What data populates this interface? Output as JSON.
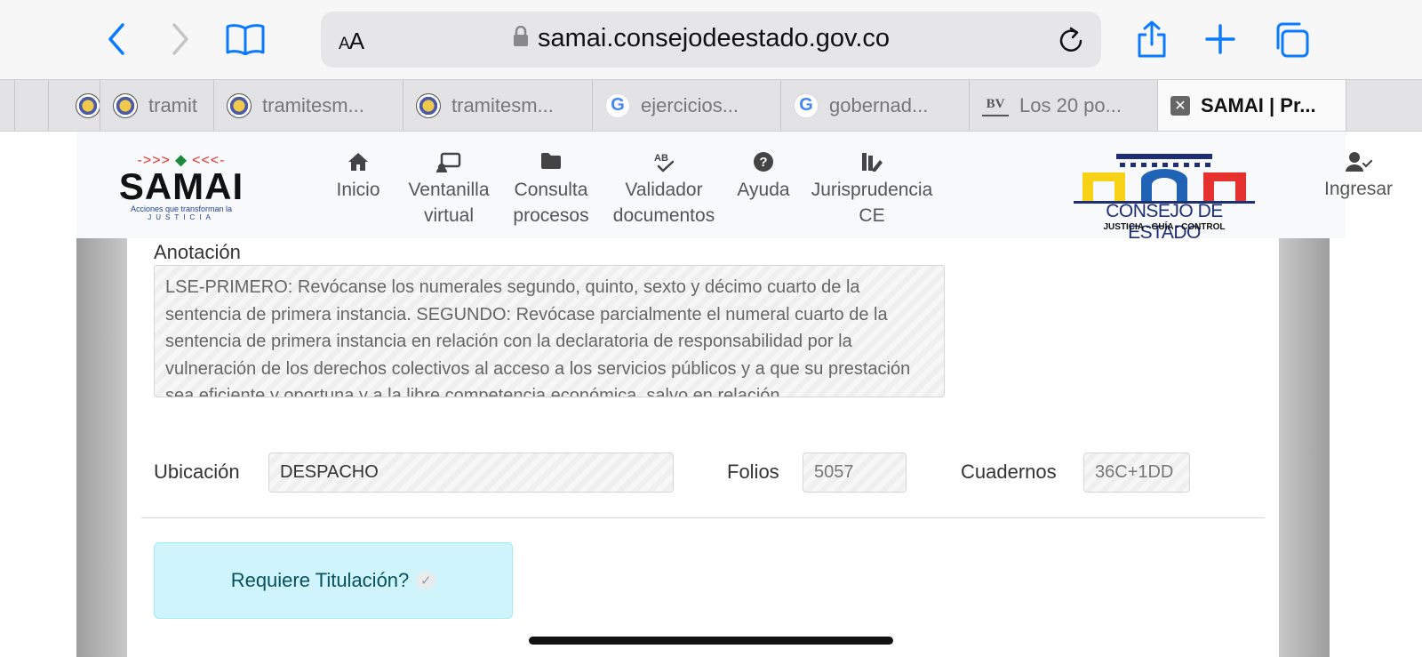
{
  "browser": {
    "text_size_label": "AA",
    "url": "samai.consejodeestado.gov.co",
    "colors": {
      "accent": "#0a7aff"
    }
  },
  "tabs": [
    {
      "label": "",
      "favicon": "coat-of-arms-icon"
    },
    {
      "label": "tramit",
      "favicon": "coat-of-arms-icon"
    },
    {
      "label": "tramitesm...",
      "favicon": "coat-of-arms-icon"
    },
    {
      "label": "tramitesm...",
      "favicon": "coat-of-arms-icon"
    },
    {
      "label": "ejercicios...",
      "favicon": "google-icon"
    },
    {
      "label": "gobernad...",
      "favicon": "google-icon"
    },
    {
      "label": "Los 20 po...",
      "favicon": "bv-icon"
    },
    {
      "label": "SAMAI | Pr...",
      "favicon": "close-icon",
      "active": true
    }
  ],
  "site": {
    "logo": {
      "word": "SAMAI",
      "tagline": "Acciones que transforman la",
      "tagline2": "JUSTICIA"
    },
    "nav": {
      "inicio": "Inicio",
      "ventanilla_1": "Ventanilla",
      "ventanilla_2": "virtual",
      "consulta_1": "Consulta",
      "consulta_2": "procesos",
      "validador_1": "Validador",
      "validador_2": "documentos",
      "ayuda": "Ayuda",
      "juris_1": "Jurisprudencia",
      "juris_2": "CE",
      "ingresar": "Ingresar"
    },
    "ce_logo": {
      "name": "CONSEJO DE ESTADO",
      "tagline": "JUSTICIA - GUÍA - CONTROL"
    }
  },
  "form": {
    "anotacion_label": "Anotación",
    "anotacion_value": "LSE-PRIMERO: Revócanse los numerales segundo, quinto, sexto y décimo cuarto de la sentencia de primera instancia. SEGUNDO: Revócase parcialmente el numeral cuarto de la sentencia de primera instancia en relación con la declaratoria de responsabilidad por la vulneración de los derechos colectivos al acceso a los servicios públicos y a que su prestación sea eficiente y oportuna y a la libre competencia económica, salvo en relación",
    "ubicacion_label": "Ubicación",
    "ubicacion_value": "DESPACHO",
    "folios_label": "Folios",
    "folios_value": "5057",
    "cuadernos_label": "Cuadernos",
    "cuadernos_value": "36C+1DD",
    "requiere_label": "Requiere Titulación?"
  }
}
